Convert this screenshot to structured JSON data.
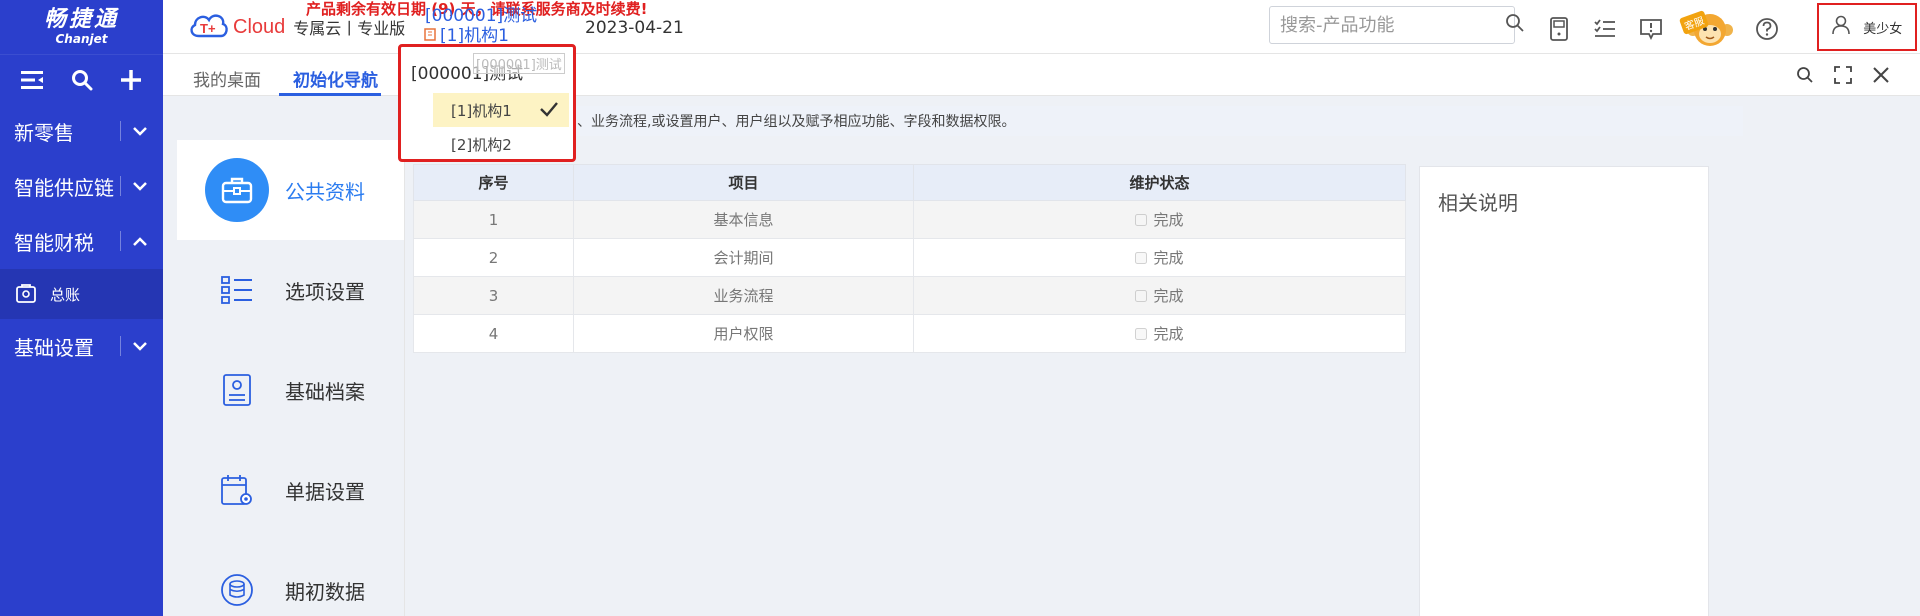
{
  "sidebar": {
    "logo_cn": "畅捷通",
    "logo_en": "Chanjet",
    "nav": [
      {
        "label": "新零售",
        "expanded": false
      },
      {
        "label": "智能供应链",
        "expanded": false
      },
      {
        "label": "智能财税",
        "expanded": true
      },
      {
        "label": "基础设置",
        "expanded": false
      }
    ],
    "sub_item": "总账"
  },
  "header": {
    "cloud_label": "Cloud",
    "edition": "专属云丨专业版",
    "promo": "产品剩余有效日期 (9) 天，请联系服务商及时续费!",
    "company": "[000001]测试",
    "org": "[1]机构1",
    "date": "2023-04-21",
    "search_placeholder": "搜索-产品功能",
    "kefu_badge": "客服",
    "username": "美少女"
  },
  "tabs": [
    {
      "label": "我的桌面",
      "active": false
    },
    {
      "label": "初始化导航",
      "active": true
    }
  ],
  "notice": "修改基本信息、会计期间、业务流程,或设置用户、用户组以及赋予相应功能、字段和数据权限。",
  "steps": [
    {
      "label": "公共资料",
      "icon": "briefcase-icon",
      "active": true
    },
    {
      "label": "选项设置",
      "icon": "checklist-icon",
      "active": false
    },
    {
      "label": "基础档案",
      "icon": "profile-card-icon",
      "active": false
    },
    {
      "label": "单据设置",
      "icon": "calendar-gear-icon",
      "active": false
    },
    {
      "label": "期初数据",
      "icon": "database-icon",
      "active": false
    }
  ],
  "table": {
    "headers": [
      "序号",
      "项目",
      "维护状态"
    ],
    "rows": [
      {
        "no": "1",
        "item": "基本信息",
        "status": "完成"
      },
      {
        "no": "2",
        "item": "会计期间",
        "status": "完成"
      },
      {
        "no": "3",
        "item": "业务流程",
        "status": "完成"
      },
      {
        "no": "4",
        "item": "用户权限",
        "status": "完成"
      }
    ]
  },
  "right_panel": {
    "title": "相关说明"
  },
  "dropdown": {
    "head": "[000001]测试",
    "ghost": "[000001]测试",
    "options": [
      {
        "label": "[1]机构1",
        "selected": true
      },
      {
        "label": "[2]机构2",
        "selected": false
      }
    ]
  },
  "colors": {
    "sidebar": "#2b3fcc",
    "accent": "#2b5fe0",
    "alert": "#e02020"
  }
}
